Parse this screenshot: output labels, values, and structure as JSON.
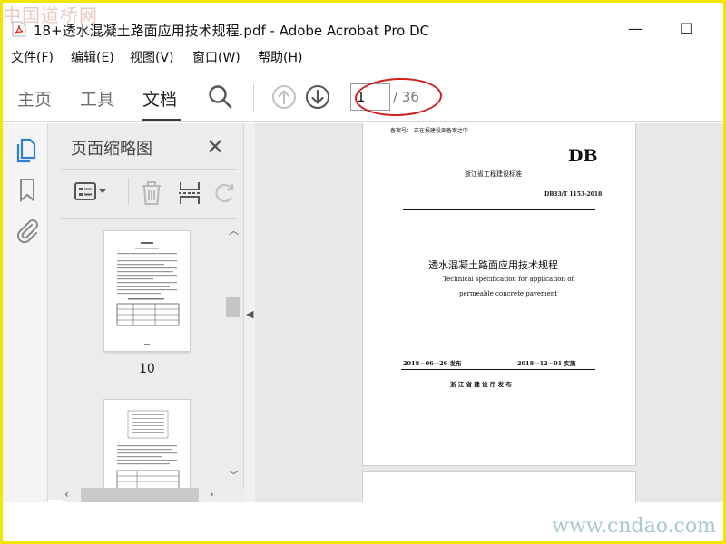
{
  "watermark": {
    "top": "中国道桥网",
    "bottom": "www.cndao.com"
  },
  "window": {
    "title": "18+透水混凝土路面应用技术规程.pdf - Adobe Acrobat Pro DC",
    "minimize": "—",
    "maximize": "☐"
  },
  "menu": [
    {
      "label": "文件(F)"
    },
    {
      "label": "编辑(E)"
    },
    {
      "label": "视图(V)"
    },
    {
      "label": "窗口(W)"
    },
    {
      "label": "帮助(H)"
    }
  ],
  "toolbar": {
    "tabs": [
      "主页",
      "工具",
      "文档"
    ],
    "active_tab": "文档",
    "page_current": "1",
    "page_total": "/ 36",
    "highlight_color": "#d32020"
  },
  "panel": {
    "title": "页面缩略图",
    "close": "✕",
    "thumbnails": [
      {
        "label": "10"
      },
      {
        "label": ""
      }
    ]
  },
  "document": {
    "record_no": "备案号：  正在报建设部备案之中",
    "standard_code": "DB",
    "standard_org": "浙江省工程建设标准",
    "standard_number": "DB33/T 1153-2018",
    "title_cn": "透水混凝土路面应用技术规程",
    "title_en_1": "Technical specification for application of",
    "title_en_2": "permeable concrete pavement",
    "issue_date": "2018—06—26 发布",
    "impl_date": "2018—12—01  实施",
    "publisher": "浙  江  省  建  设  厅        发  布"
  },
  "colors": {
    "accent": "#2d7fd0",
    "active_icon": "#2d7fd0"
  }
}
